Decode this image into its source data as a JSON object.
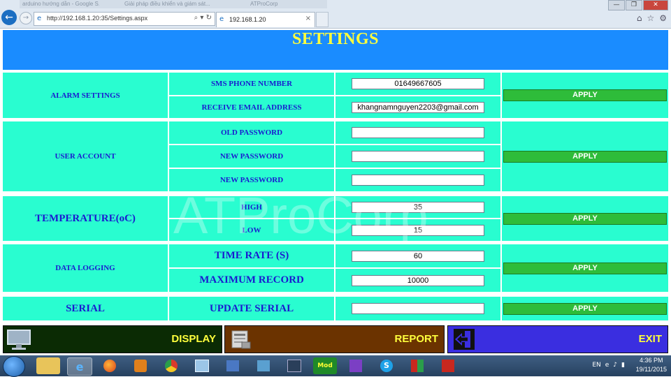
{
  "browser": {
    "ghost_tabs": [
      "arduino hướng dẫn - Google S...",
      "Giải pháp điều khiển và giám sát...",
      "ATProCorp"
    ],
    "url": "http://192.168.1.20:35/Settings.aspx",
    "tab_title": "192.168.1.20",
    "tab_close": "×",
    "back_glyph": "←",
    "forward_glyph": "→",
    "address_tools": "⌕ ▾ ↻",
    "toolbar_icons": [
      "⌂",
      "☆",
      "⚙"
    ],
    "window_buttons": [
      "—",
      "❐",
      "✕"
    ]
  },
  "page": {
    "title": "SETTINGS",
    "watermark": "ATProCorp",
    "apply_label": "APPLY",
    "alarm": {
      "section": "ALARM SETTINGS",
      "sms_label": "SMS PHONE NUMBER",
      "sms_value": "01649667605",
      "email_label": "RECEIVE EMAIL ADDRESS",
      "email_value": "khangnamnguyen2203@gmail.com"
    },
    "user": {
      "section": "USER ACCOUNT",
      "old_label": "OLD PASSWORD",
      "new_label": "NEW PASSWORD",
      "confirm_label": "NEW PASSWORD",
      "old_value": "",
      "new_value": "",
      "confirm_value": ""
    },
    "temperature": {
      "section": "TEMPERATURE(oC)",
      "high_label": "HIGH",
      "high_value": "35",
      "low_label": "LOW",
      "low_value": "15"
    },
    "logging": {
      "section": "DATA LOGGING",
      "rate_label": "TIME RATE (S)",
      "rate_value": "60",
      "max_label": "MAXIMUM RECORD",
      "max_value": "10000"
    },
    "serial": {
      "section": "SERIAL",
      "update_label": "UPDATE SERIAL",
      "update_value": ""
    }
  },
  "nav": {
    "display": "DISPLAY",
    "report": "REPORT",
    "exit": "EXIT",
    "colors": {
      "display": "#0b2b04",
      "report": "#6b3300",
      "exit": "#3a2ee0"
    }
  },
  "taskbar": {
    "apps": [
      "file-explorer",
      "internet-explorer",
      "firefox",
      "media-player",
      "chrome",
      "network",
      "settings",
      "tools",
      "sql",
      "mod",
      "visual-studio",
      "skype",
      "flash",
      "acrobat"
    ],
    "mod_label": "Mod",
    "language": "EN",
    "time": "4:36 PM",
    "date": "19/11/2015"
  },
  "colors": {
    "header": "#1a8cff",
    "cell": "#29fdd0",
    "label": "#1a1ad0",
    "title": "#ffff3c",
    "apply": "#2ebc3a"
  }
}
